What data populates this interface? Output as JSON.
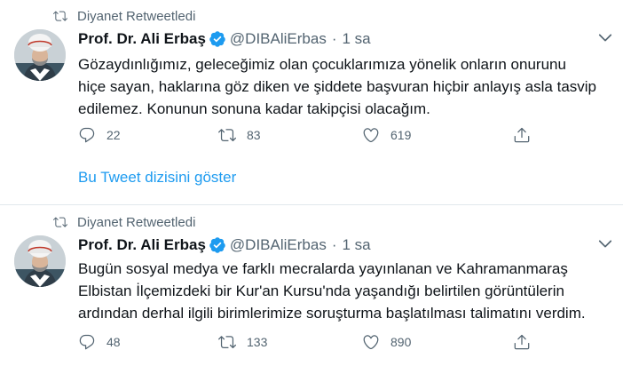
{
  "tweets": [
    {
      "retweeted_by": "Diyanet Retweetledi",
      "author_name": "Prof. Dr. Ali Erbaş",
      "handle": "@DIBAliErbas",
      "separator": "·",
      "time": "1 sa",
      "lines": [
        "Gözaydınlığımız, geleceğimiz olan çocuklarımıza yönelik onların onurunu",
        "hiçe sayan, haklarına göz diken ve şiddete başvuran hiçbir anlayış asla tasvip",
        "edilemez. Konunun sonuna kadar takipçisi olacağım."
      ],
      "replies": "22",
      "retweets": "83",
      "likes": "619",
      "thread_link": "Bu Tweet dizisini göster"
    },
    {
      "retweeted_by": "Diyanet Retweetledi",
      "author_name": "Prof. Dr. Ali Erbaş",
      "handle": "@DIBAliErbas",
      "separator": "·",
      "time": "1 sa",
      "lines": [
        "Bugün sosyal medya ve farklı mecralarda yayınlanan ve Kahramanmaraş",
        "Elbistan İlçemizdeki bir Kur'an Kursu'nda yaşandığı belirtilen görüntülerin",
        "ardından derhal ilgili birimlerimize soruşturma başlatılması talimatını verdim."
      ],
      "replies": "48",
      "retweets": "133",
      "likes": "890"
    }
  ],
  "colors": {
    "text": "#0f1419",
    "secondary": "#536471",
    "accent": "#1d9bf0",
    "divider": "#e1e8ed"
  },
  "icons": {
    "retweet_indicator": "retweet-icon",
    "verified": "verified-badge-icon",
    "more": "chevron-down-icon",
    "reply": "reply-icon",
    "retweet": "retweet-icon",
    "like": "heart-icon",
    "share": "share-icon"
  }
}
